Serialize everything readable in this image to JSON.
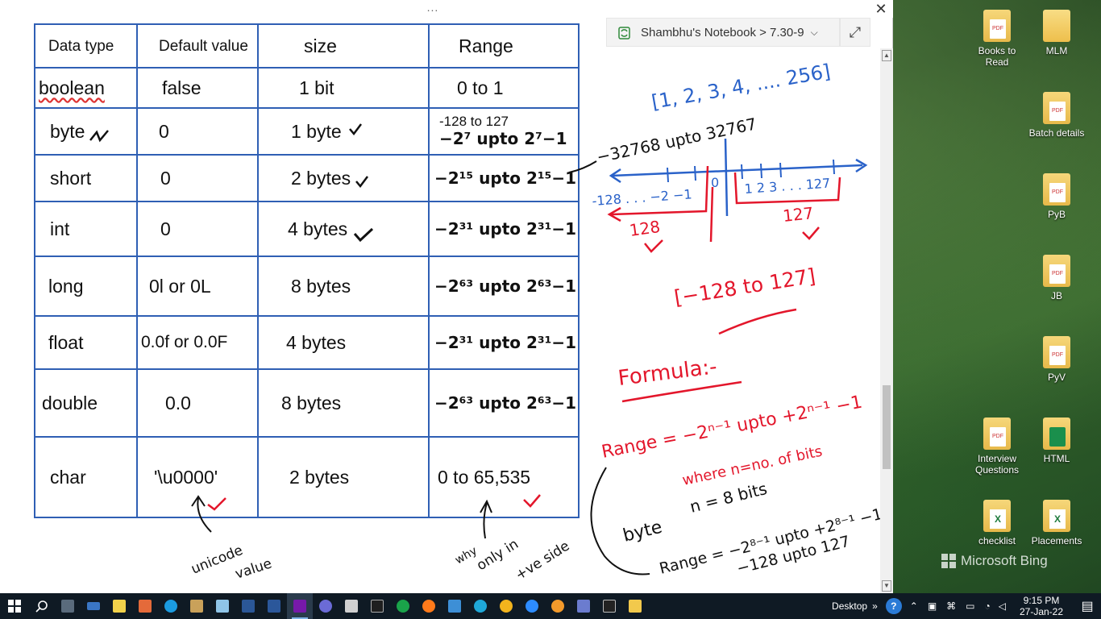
{
  "window": {
    "drag_handle": "...",
    "close_label": "✕",
    "breadcrumb": "Shambhu's Notebook > 7.30-9",
    "expand_label": "⤢"
  },
  "table": {
    "headers": [
      "Data type",
      "Default value",
      "size",
      "Range"
    ],
    "rows": [
      {
        "type": "boolean",
        "default": "false",
        "size": "1 bit",
        "range": "0 to 1"
      },
      {
        "type": "byte",
        "default": "0",
        "size": "1 byte",
        "range_top": "-128 to 127",
        "range": "−2⁷ upto 2⁷−1"
      },
      {
        "type": "short",
        "default": "0",
        "size": "2 bytes",
        "range": "−2¹⁵ upto 2¹⁵−1"
      },
      {
        "type": "int",
        "default": "0",
        "size": "4 bytes",
        "range": "−2³¹ upto 2³¹−1"
      },
      {
        "type": "long",
        "default": "0l or 0L",
        "size": "8 bytes",
        "range": "−2⁶³ upto 2⁶³−1"
      },
      {
        "type": "float",
        "default": "0.0f or 0.0F",
        "size": "4 bytes",
        "range": "−2³¹ upto 2³¹−1"
      },
      {
        "type": "double",
        "default": "0.0",
        "size": "8 bytes",
        "range": "−2⁶³ upto 2⁶³−1"
      },
      {
        "type": "char",
        "default": "'\\u0000'",
        "size": "2 bytes",
        "range": "0 to 65,535"
      }
    ]
  },
  "ink": {
    "set_notation": "[1, 2, 3, 4, .... 256]",
    "short_range": "−32768 upto 32767",
    "number_line_neg": "-128 . . . −2 −1",
    "zero": "0",
    "number_line_pos": "1 2 3 . . . 127",
    "count_neg": "128",
    "count_pos": "127",
    "byte_bracket": "[−128 to 127]",
    "formula_heading": "Formula:-",
    "formula": "Range = −2ⁿ⁻¹ upto +2ⁿ⁻¹ −1",
    "where_note": "where n=no. of bits",
    "byte_label": "byte",
    "byte_n": "n = 8 bits",
    "byte_range": "Range = −2⁸⁻¹ upto +2⁸⁻¹ −1",
    "byte_result": "−128 upto 127",
    "unicode_note1": "unicode",
    "unicode_note2": "value",
    "why_note1": "why",
    "why_note2": "only in",
    "why_note3": "+ve side"
  },
  "desktop": {
    "icons": [
      {
        "label": "Books to Read",
        "kind": "pdf"
      },
      {
        "label": "MLM",
        "kind": "plain"
      },
      {
        "label": "Batch details",
        "kind": "pdf"
      },
      {
        "label": "PyB",
        "kind": "pdf"
      },
      {
        "label": "JB",
        "kind": "pdf"
      },
      {
        "label": "PyV",
        "kind": "pdf"
      },
      {
        "label": "Interview Questions",
        "kind": "pdf"
      },
      {
        "label": "HTML",
        "kind": "html"
      },
      {
        "label": "checklist",
        "kind": "xls"
      },
      {
        "label": "Placements",
        "kind": "xls"
      }
    ],
    "bing_label": "Microsoft Bing"
  },
  "taskbar": {
    "desktop_label": "Desktop",
    "chevron": "»",
    "help": "?",
    "time": "9:15 PM",
    "date": "27-Jan-22"
  },
  "colors": {
    "table_border": "#2f5fb4",
    "ink_blue": "#2a62c9",
    "ink_red": "#e3162b",
    "ink_black": "#111111"
  }
}
